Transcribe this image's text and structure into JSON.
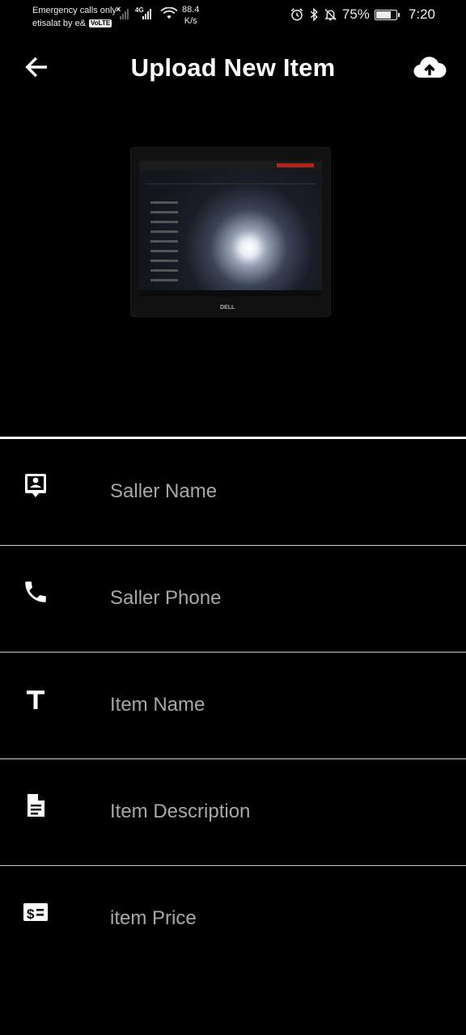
{
  "status_bar": {
    "carrier_line1": "Emergency calls only",
    "carrier_line2": "etisalat by e&",
    "volte_badge": "VoLTE",
    "network_type": "4G",
    "net_speed_value": "88.4",
    "net_speed_unit": "K/s",
    "battery_percent": "75%",
    "time": "7:20",
    "battery_level": 0.75,
    "icons": [
      "signal-x-icon",
      "signal-icon",
      "wifi-icon",
      "alarm-icon",
      "bluetooth-icon",
      "mute-bell-icon",
      "battery-icon"
    ]
  },
  "app_bar": {
    "title": "Upload New Item",
    "back_icon": "arrow-left-icon",
    "action_icon": "cloud-upload-icon"
  },
  "photo": {
    "brand_text": "DELL"
  },
  "form": {
    "fields": [
      {
        "name": "seller-name",
        "icon": "contact-badge-icon",
        "placeholder": "Saller Name",
        "value": ""
      },
      {
        "name": "seller-phone",
        "icon": "phone-icon",
        "placeholder": "Saller Phone",
        "value": ""
      },
      {
        "name": "item-name",
        "icon": "text-t-icon",
        "placeholder": "Item Name",
        "value": ""
      },
      {
        "name": "item-description",
        "icon": "document-icon",
        "placeholder": "Item Description",
        "value": ""
      },
      {
        "name": "item-price",
        "icon": "price-tag-icon",
        "placeholder": "item Price",
        "value": ""
      }
    ]
  },
  "colors": {
    "background": "#000000",
    "foreground": "#ffffff",
    "placeholder": "#a8a8a8",
    "divider": "#cfcfcf"
  }
}
